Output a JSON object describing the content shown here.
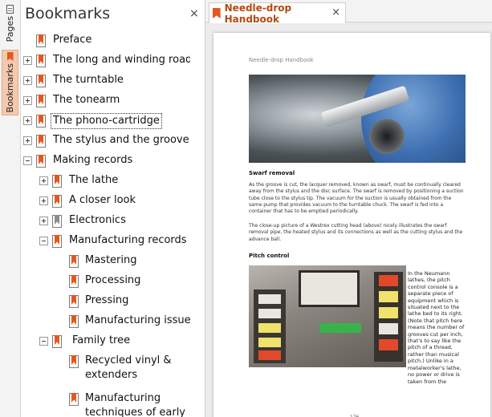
{
  "side_tabs": {
    "pages_label": "Pages",
    "bookmarks_label": "Bookmarks"
  },
  "panel": {
    "title": "Bookmarks",
    "close_glyph": "×",
    "items": [
      {
        "label": "Preface",
        "level": 0,
        "expander": "none",
        "icon": "orange"
      },
      {
        "label": "The long and winding road",
        "level": 0,
        "expander": "plus",
        "icon": "orange"
      },
      {
        "label": "The turntable",
        "level": 0,
        "expander": "plus",
        "icon": "orange"
      },
      {
        "label": "The tonearm",
        "level": 0,
        "expander": "plus",
        "icon": "orange"
      },
      {
        "label": "The phono-cartridge",
        "level": 0,
        "expander": "plus",
        "icon": "orange",
        "selected": true
      },
      {
        "label": "The stylus and the groove",
        "level": 0,
        "expander": "plus",
        "icon": "orange"
      },
      {
        "label": "Making records",
        "level": 0,
        "expander": "minus",
        "icon": "orange"
      },
      {
        "label": "The lathe",
        "level": 1,
        "expander": "plus",
        "icon": "orange"
      },
      {
        "label": "A closer look",
        "level": 1,
        "expander": "plus",
        "icon": "orange"
      },
      {
        "label": "Electronics",
        "level": 1,
        "expander": "plus",
        "icon": "gray"
      },
      {
        "label": "Manufacturing records",
        "level": 1,
        "expander": "minus",
        "icon": "orange"
      },
      {
        "label": "Mastering",
        "level": 2,
        "expander": "none",
        "icon": "orange"
      },
      {
        "label": "Processing",
        "level": 2,
        "expander": "none",
        "icon": "orange"
      },
      {
        "label": "Pressing",
        "level": 2,
        "expander": "none",
        "icon": "orange"
      },
      {
        "label": "Manufacturing issues",
        "level": 2,
        "expander": "none",
        "icon": "orange"
      },
      {
        "label": "Family tree",
        "level": 1,
        "expander": "minus",
        "icon": "orange"
      },
      {
        "label": "Recycled vinyl & extenders",
        "level": 2,
        "expander": "none",
        "icon": "orange",
        "wrap": true
      },
      {
        "label": "Manufacturing techniques of early",
        "level": 2,
        "expander": "none",
        "icon": "orange",
        "wrap": true
      }
    ]
  },
  "doc": {
    "tab_title": "Needle-drop Handbook",
    "tab_close": "×",
    "page": {
      "running_head": "Needle-drop Handbook",
      "section1_title": "Swarf removal",
      "section1_para1": "As the groove is cut, the lacquer removed, known as swarf, must be continually cleared away from the stylus and the disc surface. The swarf is removed by positioning a suction tube close to the stylus tip. The vacuum for the suction is usually obtained from the same pump that provides vacuum to the turntable chuck. The swarf is fed into a container that has to be emptied periodically.",
      "section1_para2": "The close-up picture of a Westrex cutting head (above) nicely illustrates the swarf removal pipe, the heated stylus and its connections as well as the cutting stylus and the advance ball.",
      "section2_title": "Pitch control",
      "section2_text": "In the Neumann lathes, the pitch control console is a separate piece of equipment which is situated next to the lathe bed to its right. (Note that pitch here means the number of grooves cut per inch, that's to say like the pitch of a thread, rather than musical pitch.) Unlike in a metalworker's lathe, no power or drive is taken from the",
      "page_number": "176"
    }
  }
}
